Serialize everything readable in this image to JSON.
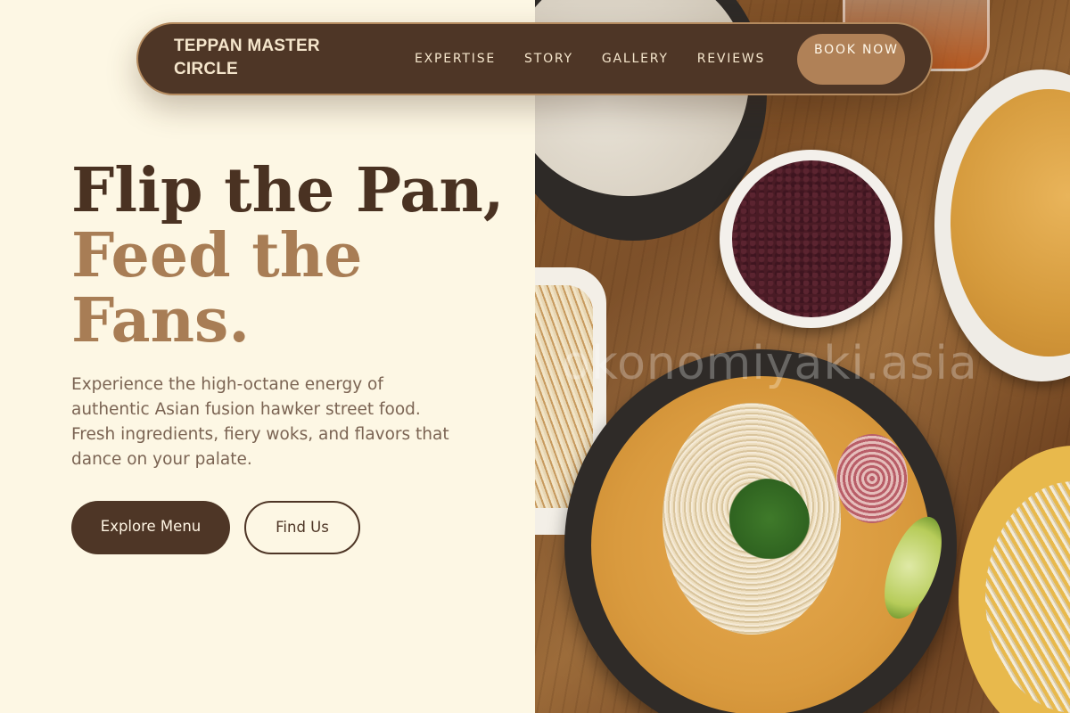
{
  "nav": {
    "brand": "TEPPAN MASTER CIRCLE",
    "links": [
      "EXPERTISE",
      "STORY",
      "GALLERY",
      "REVIEWS"
    ],
    "book_label": "BOOK NOW"
  },
  "hero": {
    "title_line1": "Flip the Pan,",
    "title_line2": "Feed the Fans.",
    "description": "Experience the high-octane energy of authentic Asian fusion hawker street food. Fresh ingredients, fiery woks, and flavors that dance on your palate.",
    "primary_button": "Explore Menu",
    "secondary_button": "Find Us"
  },
  "photo": {
    "watermark": "okonomiyaki.asia"
  },
  "colors": {
    "background": "#fdf7e4",
    "dark_brown": "#4e3626",
    "accent_tan": "#a87d55",
    "text_muted": "#7b6453"
  }
}
